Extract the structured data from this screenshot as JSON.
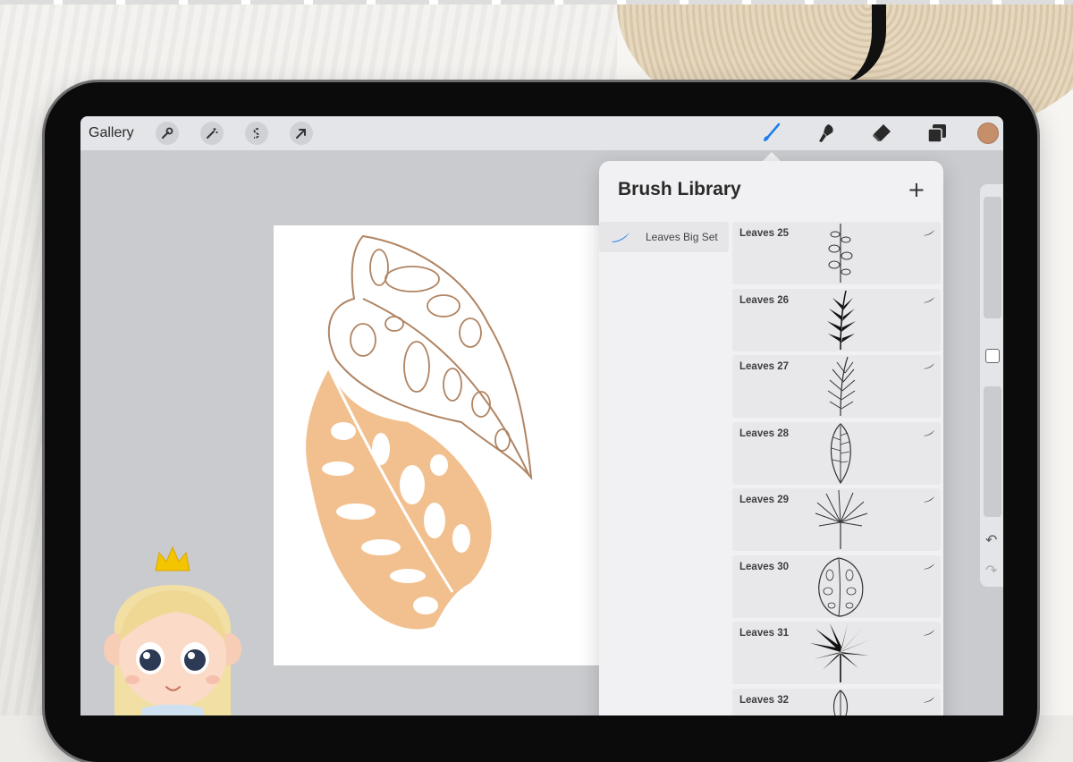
{
  "toolbar": {
    "gallery_label": "Gallery",
    "left_icons": [
      "wrench-icon",
      "magic-wand-icon",
      "selection-icon",
      "transform-arrow-icon"
    ],
    "right_icons": [
      "brush-icon",
      "smudge-icon",
      "eraser-icon",
      "layers-icon"
    ],
    "active_color": "#c58f6a",
    "accent": "#1b7cf0"
  },
  "panel": {
    "title": "Brush Library",
    "add_label": "+",
    "sets": [
      {
        "label": "Leaves Big Set"
      }
    ],
    "brushes": [
      {
        "name": "Leaves 25"
      },
      {
        "name": "Leaves 26"
      },
      {
        "name": "Leaves 27"
      },
      {
        "name": "Leaves 28"
      },
      {
        "name": "Leaves 29"
      },
      {
        "name": "Leaves 30"
      },
      {
        "name": "Leaves 31"
      },
      {
        "name": "Leaves 32"
      }
    ]
  },
  "side_rail": {
    "undo": "↶",
    "redo": "↷"
  },
  "colors": {
    "outline_leaf": "#b08462",
    "filled_leaf": "#f2c08f"
  }
}
